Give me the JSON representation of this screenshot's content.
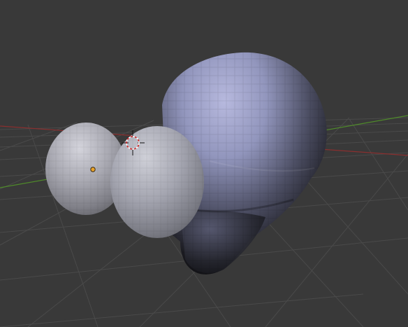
{
  "viewport": {
    "background": "#393939",
    "grid_color": "#4a4a4a",
    "x_axis_color": "#8a2f2f",
    "y_axis_color": "#4f8a2a"
  },
  "scene": {
    "objects": [
      "head-mesh",
      "left-eye-sphere",
      "right-eye-sphere"
    ],
    "material_highlight": "#a9acd1",
    "material_shadow": "#0f0f12",
    "eye_highlight": "#c8c8d0",
    "eye_shadow": "#6e6e72"
  },
  "icons": {
    "cursor": "3d-cursor-icon",
    "origin": "object-origin-icon"
  }
}
